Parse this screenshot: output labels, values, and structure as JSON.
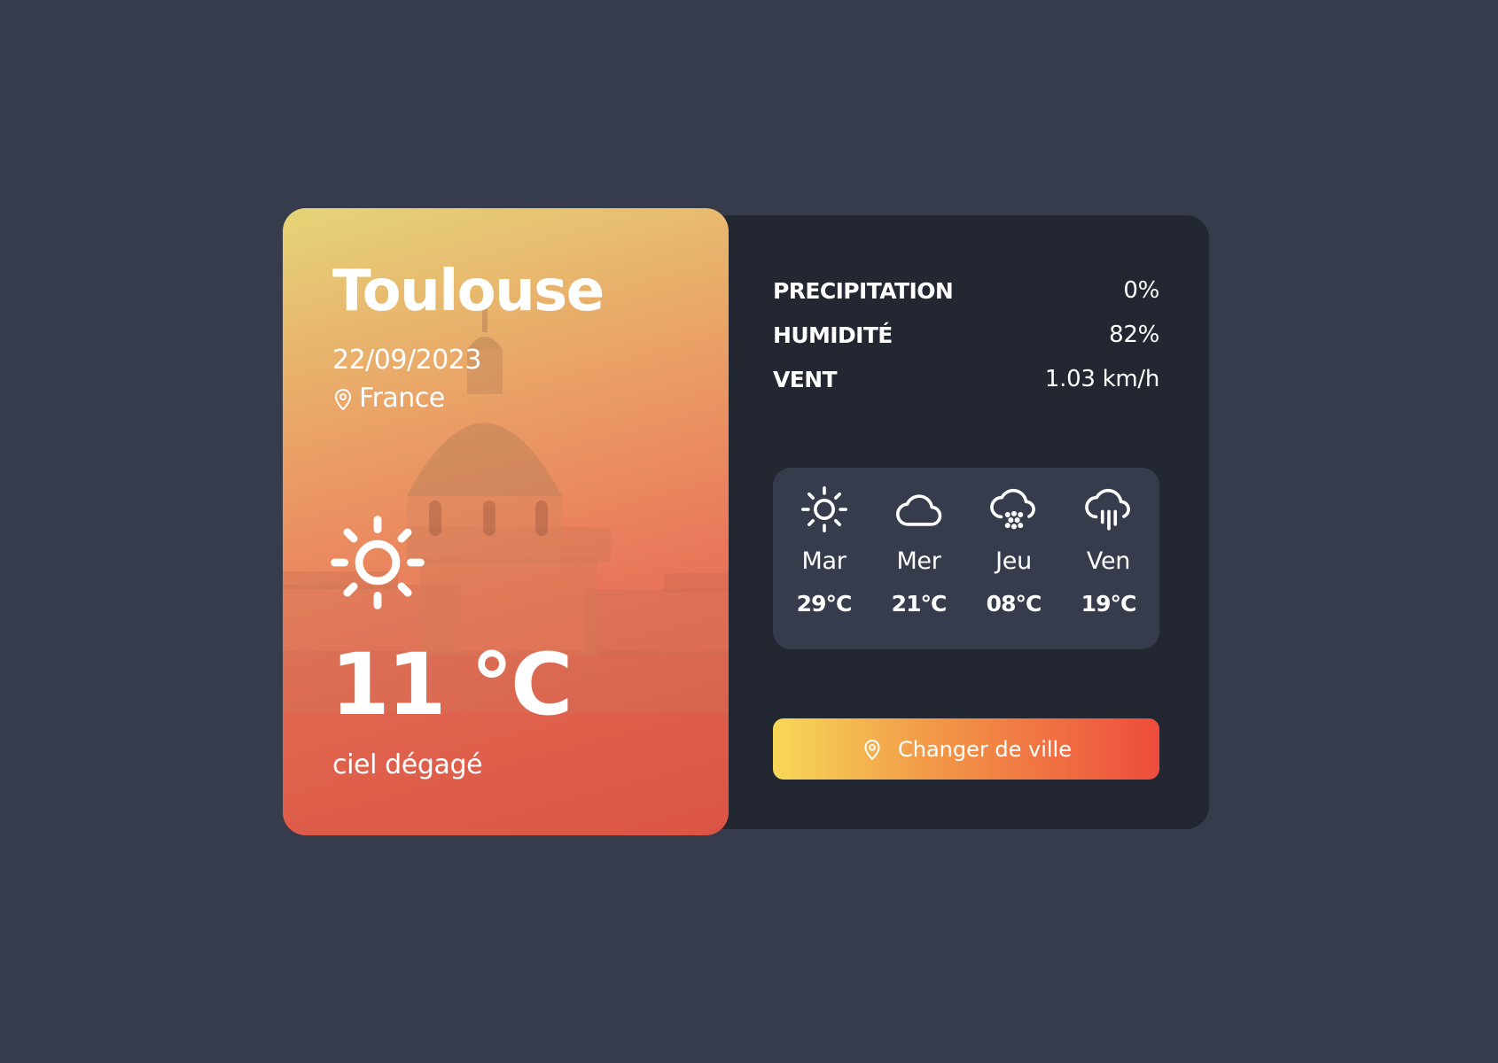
{
  "current": {
    "city": "Toulouse",
    "date": "22/09/2023",
    "country": "France",
    "temperature": "11 °C",
    "description": "ciel dégagé",
    "icon": "sun-icon"
  },
  "details": [
    {
      "label": "PRECIPITATION",
      "value": "0%"
    },
    {
      "label": "HUMIDITÉ",
      "value": "82%"
    },
    {
      "label": "VENT",
      "value": "1.03 km/h"
    }
  ],
  "forecast": [
    {
      "day": "Mar",
      "temp": "29°C",
      "icon": "sun-icon"
    },
    {
      "day": "Mer",
      "temp": "21°C",
      "icon": "cloud-icon"
    },
    {
      "day": "Jeu",
      "temp": "08°C",
      "icon": "cloud-drizzle-icon"
    },
    {
      "day": "Ven",
      "temp": "19°C",
      "icon": "cloud-rain-icon"
    }
  ],
  "button": {
    "label": "Changer de ville",
    "icon": "map-pin-icon"
  },
  "colors": {
    "background": "#363c4b",
    "panel": "#222731",
    "forecast_box": "#363c4b",
    "gradient_start": "#f7d858",
    "gradient_end": "#ee4c3c"
  }
}
